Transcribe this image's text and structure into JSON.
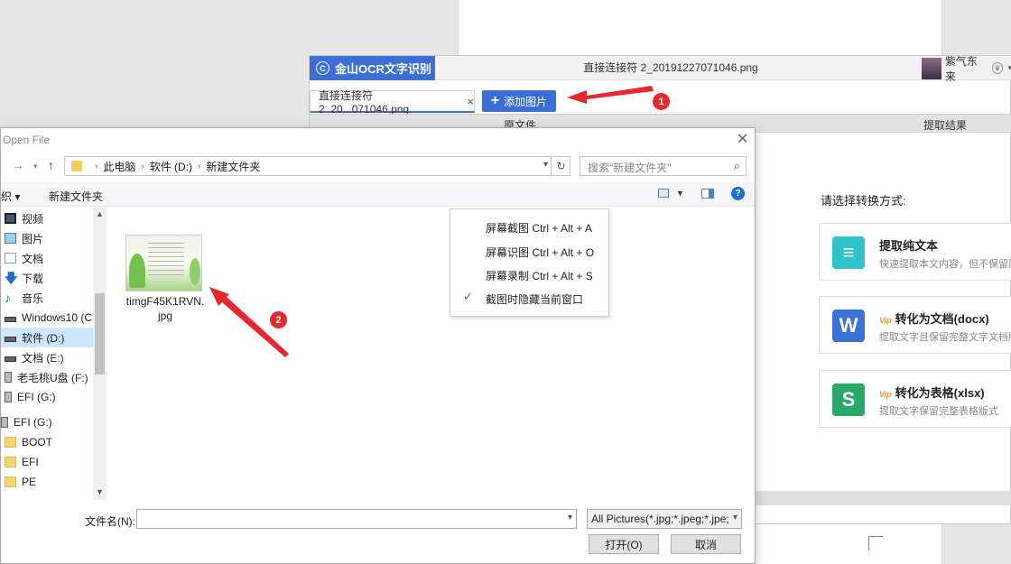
{
  "ocr_app": {
    "name": "金山OCR文字识别",
    "window_title": "直接连接符 2_20191227071046.png",
    "user_name": "紫气东来",
    "tab_label": "直接连接符 2_20...071046.png",
    "tab_close": "×",
    "add_image_label": "添加图片",
    "col_source": "原文件",
    "col_result": "提取结果",
    "convert_prompt": "请选择转换方式:",
    "options": [
      {
        "title": "提取纯文本",
        "desc": "快速提取本文内容，但不保留原",
        "icon": "text-icon",
        "color": "#2fc2c8",
        "vip": false
      },
      {
        "title": "转化为文档(docx)",
        "desc": "提取文字且保留完整文字文档版",
        "icon": "word-icon",
        "color": "#3a72d8",
        "vip": true
      },
      {
        "title": "转化为表格(xlsx)",
        "desc": "提取文字保留完整表格版式",
        "icon": "excel-icon",
        "color": "#27a866",
        "vip": true
      }
    ],
    "vip_label": "Vip"
  },
  "capture_menu": {
    "items": [
      {
        "label": "屏幕截图 Ctrl + Alt + A",
        "checked": false
      },
      {
        "label": "屏幕识图 Ctrl + Alt + O",
        "checked": false
      },
      {
        "label": "屏幕录制 Ctrl + Alt + S",
        "checked": false
      },
      {
        "label": "截图时隐藏当前窗口",
        "checked": true
      }
    ]
  },
  "dialog": {
    "title": "Open File",
    "breadcrumb": [
      "此电脑",
      "软件 (D:)",
      "新建文件夹"
    ],
    "search_placeholder": "搜索\"新建文件夹\"",
    "organize_label": "织 ▾",
    "new_folder_label": "新建文件夹",
    "nav_items": [
      {
        "label": "视频",
        "icon": "video-icon"
      },
      {
        "label": "图片",
        "icon": "pictures-icon"
      },
      {
        "label": "文档",
        "icon": "documents-icon"
      },
      {
        "label": "下载",
        "icon": "downloads-icon"
      },
      {
        "label": "音乐",
        "icon": "music-icon"
      },
      {
        "label": "Windows10 (C:",
        "icon": "drive-icon"
      },
      {
        "label": "软件 (D:)",
        "icon": "drive-icon",
        "selected": true
      },
      {
        "label": "文档 (E:)",
        "icon": "drive-icon"
      },
      {
        "label": "老毛桃U盘 (F:)",
        "icon": "usb-icon"
      },
      {
        "label": "EFI (G:)",
        "icon": "usb-icon"
      },
      {
        "label": "EFI (G:)",
        "icon": "usb-icon"
      },
      {
        "label": "BOOT",
        "icon": "folder-icon"
      },
      {
        "label": "EFI",
        "icon": "folder-icon"
      },
      {
        "label": "PE",
        "icon": "folder-icon"
      }
    ],
    "file": {
      "name_line1": "timgF45K1RVN.",
      "name_line2": "jpg"
    },
    "filename_label": "文件名(N):",
    "filename_value": "",
    "filter_value": "All Pictures(*.jpg;*.jpeg;*.jpe;",
    "open_label": "打开(O)",
    "cancel_label": "取消"
  },
  "annotations": {
    "step1": "1",
    "step2": "2",
    "color": "#e8262c"
  }
}
